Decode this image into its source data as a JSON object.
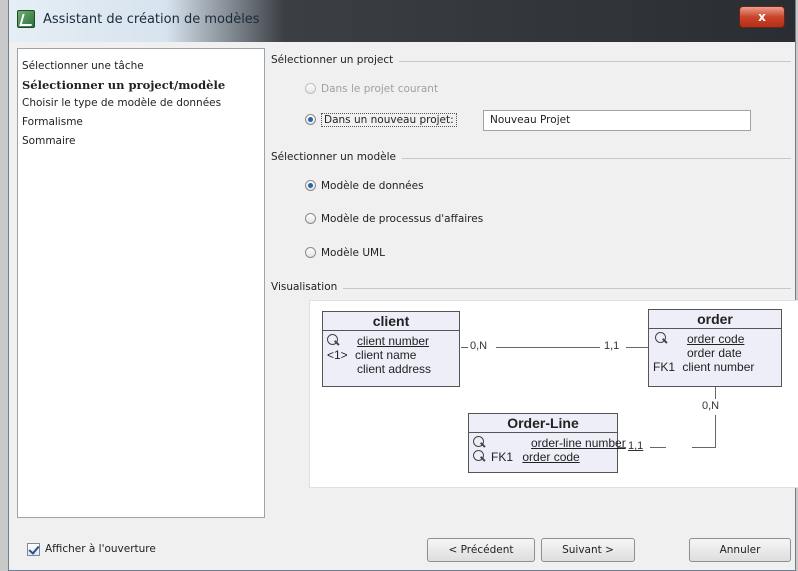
{
  "window": {
    "title": "Assistant de création de modèles",
    "close_label": "x"
  },
  "sidebar": {
    "items": [
      {
        "label": "Sélectionner une tâche"
      },
      {
        "label": "Sélectionner un project/modèle"
      },
      {
        "label": "Choisir le type de modèle de données"
      },
      {
        "label": "Formalisme"
      },
      {
        "label": "Sommaire"
      }
    ],
    "active_index": 1
  },
  "project_group": {
    "title": "Sélectionner un project",
    "option_current": "Dans le projet courant",
    "option_new": "Dans un nouveau projet:",
    "selected": "new",
    "new_project_value": "Nouveau Projet"
  },
  "model_group": {
    "title": "Sélectionner un modèle",
    "options": [
      "Modèle de données",
      "Modèle de processus d'affaires",
      "Modèle UML"
    ],
    "selected_index": 0
  },
  "visualisation": {
    "title": "Visualisation",
    "entities": {
      "client": {
        "name": "client",
        "attrs": [
          "client number",
          "client name",
          "client address"
        ],
        "prefixes": [
          "",
          "<1>",
          ""
        ]
      },
      "order": {
        "name": "order",
        "attrs": [
          "order code",
          "order date",
          "client number"
        ],
        "prefixes": [
          "",
          "",
          "FK1"
        ]
      },
      "order_line": {
        "name": "Order-Line",
        "attrs": [
          "order-line number",
          "order code"
        ],
        "prefixes": [
          "",
          "FK1"
        ]
      }
    },
    "cardinalities": {
      "client_order_left": "0,N",
      "client_order_right": "1,1",
      "order_line_top": "0,N",
      "order_line_left": "1,1"
    }
  },
  "footer": {
    "show_on_open_label": "Afficher à l'ouverture",
    "show_on_open_checked": true,
    "prev_label": "< Précédent",
    "next_label": "Suivant >",
    "cancel_label": "Annuler"
  },
  "colors": {
    "accent": "#2b62b8",
    "entity_fill": "#eeeef8",
    "close_red": "#c9442a"
  }
}
